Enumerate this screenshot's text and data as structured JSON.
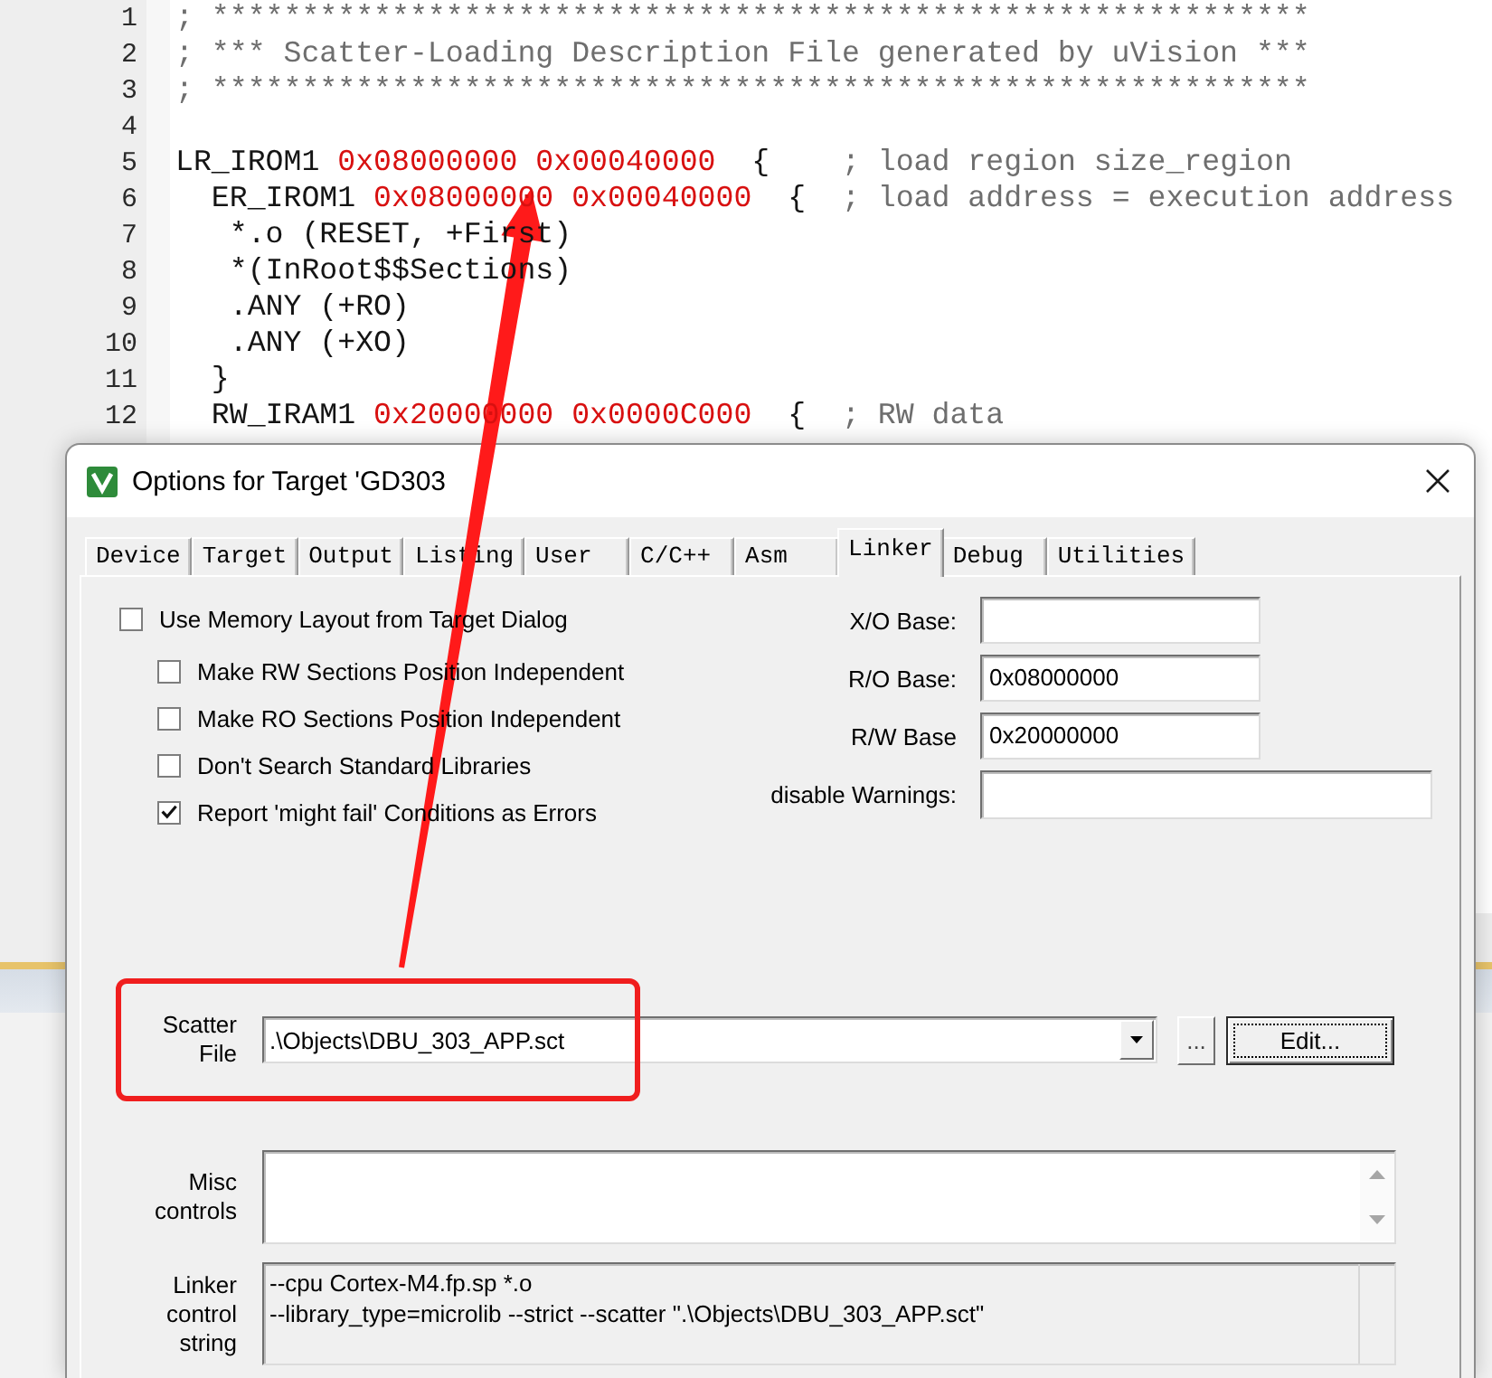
{
  "editor": {
    "lines": [
      {
        "number": "1",
        "segments": [
          {
            "kind": "comment",
            "text": "; *************************************************************"
          }
        ]
      },
      {
        "number": "2",
        "segments": [
          {
            "kind": "comment",
            "text": "; *** Scatter-Loading Description File generated by uVision ***"
          }
        ]
      },
      {
        "number": "3",
        "segments": [
          {
            "kind": "comment",
            "text": "; *************************************************************"
          }
        ]
      },
      {
        "number": "4"
      },
      {
        "number": "5",
        "segments": [
          {
            "kind": "plain",
            "text": "LR_IROM1 "
          },
          {
            "kind": "number",
            "text": "0x08000000 0x00040000"
          },
          {
            "kind": "plain",
            "text": "  {    "
          },
          {
            "kind": "comment",
            "text": "; load region size_region"
          }
        ]
      },
      {
        "number": "6",
        "segments": [
          {
            "kind": "plain",
            "text": "  ER_IROM1 "
          },
          {
            "kind": "number",
            "text": "0x08000000 0x00040000"
          },
          {
            "kind": "plain",
            "text": "  {  "
          },
          {
            "kind": "comment",
            "text": "; load address = execution address"
          }
        ]
      },
      {
        "number": "7",
        "segments": [
          {
            "kind": "plain",
            "text": "   *.o (RESET, +First)"
          }
        ]
      },
      {
        "number": "8",
        "segments": [
          {
            "kind": "plain",
            "text": "   *(InRoot$$Sections)"
          }
        ]
      },
      {
        "number": "9",
        "segments": [
          {
            "kind": "plain",
            "text": "   .ANY (+RO)"
          }
        ]
      },
      {
        "number": "10",
        "segments": [
          {
            "kind": "plain",
            "text": "   .ANY (+XO)"
          }
        ]
      },
      {
        "number": "11",
        "segments": [
          {
            "kind": "plain",
            "text": "  }"
          }
        ]
      },
      {
        "number": "12",
        "segments": [
          {
            "kind": "plain",
            "text": "  RW_IRAM1 "
          },
          {
            "kind": "number",
            "text": "0x20000000 0x0000C000"
          },
          {
            "kind": "plain",
            "text": "  {  "
          },
          {
            "kind": "comment",
            "text": "; RW data"
          }
        ]
      }
    ]
  },
  "dialog": {
    "title": "Options for Target 'GD303",
    "tabs": [
      {
        "label": "Device",
        "selected": false
      },
      {
        "label": "Target",
        "selected": false
      },
      {
        "label": "Output",
        "selected": false
      },
      {
        "label": "Listing",
        "selected": false
      },
      {
        "label": "User",
        "selected": false
      },
      {
        "label": "C/C++",
        "selected": false
      },
      {
        "label": "Asm",
        "selected": false
      },
      {
        "label": "Linker",
        "selected": true
      },
      {
        "label": "Debug",
        "selected": false
      },
      {
        "label": "Utilities",
        "selected": false
      }
    ],
    "options": [
      {
        "label": "Use Memory Layout from Target Dialog",
        "checked": false,
        "children": [
          {
            "label": "Make RW Sections Position Independent",
            "checked": false
          },
          {
            "label": "Make RO Sections Position Independent",
            "checked": false
          },
          {
            "label": "Don't Search Standard Libraries",
            "checked": false
          },
          {
            "label": "Report 'might fail' Conditions as Errors",
            "checked": true
          }
        ]
      }
    ],
    "base_fields": [
      {
        "label": "X/O Base:"
      },
      {
        "label": "R/O Base:",
        "value": "0x08000000"
      },
      {
        "label": "R/W Base",
        "value": "0x20000000"
      },
      {
        "label": "disable Warnings:"
      }
    ],
    "scatter_file": {
      "label": "Scatter File",
      "value": ".\\Objects\\DBU_303_APP.sct",
      "browse_button": {
        "label": "..."
      },
      "edit_button": {
        "label": "Edit...",
        "focused": true
      }
    },
    "misc_controls": {
      "label": "Misc controls"
    },
    "linker_control_string": {
      "label": "Linker control string",
      "lines": [
        "--cpu Cortex-M4.fp.sp *.o",
        "--library_type=microlib --strict --scatter \".\\Objects\\DBU_303_APP.sct\""
      ]
    }
  }
}
